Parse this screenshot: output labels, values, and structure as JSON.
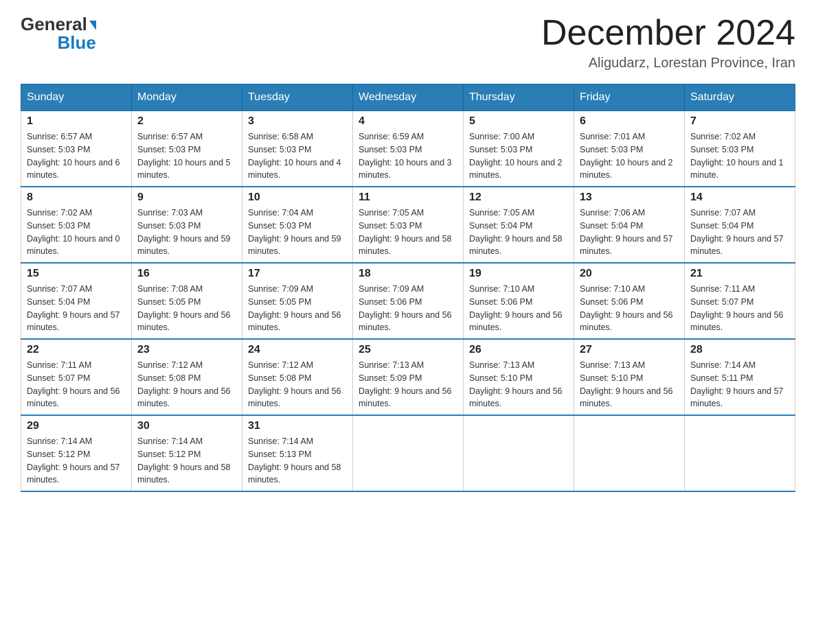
{
  "header": {
    "logo": {
      "general": "General",
      "blue": "Blue"
    },
    "title": "December 2024",
    "subtitle": "Aligudarz, Lorestan Province, Iran"
  },
  "weekdays": [
    "Sunday",
    "Monday",
    "Tuesday",
    "Wednesday",
    "Thursday",
    "Friday",
    "Saturday"
  ],
  "weeks": [
    [
      {
        "day": "1",
        "sunrise": "6:57 AM",
        "sunset": "5:03 PM",
        "daylight": "10 hours and 6 minutes."
      },
      {
        "day": "2",
        "sunrise": "6:57 AM",
        "sunset": "5:03 PM",
        "daylight": "10 hours and 5 minutes."
      },
      {
        "day": "3",
        "sunrise": "6:58 AM",
        "sunset": "5:03 PM",
        "daylight": "10 hours and 4 minutes."
      },
      {
        "day": "4",
        "sunrise": "6:59 AM",
        "sunset": "5:03 PM",
        "daylight": "10 hours and 3 minutes."
      },
      {
        "day": "5",
        "sunrise": "7:00 AM",
        "sunset": "5:03 PM",
        "daylight": "10 hours and 2 minutes."
      },
      {
        "day": "6",
        "sunrise": "7:01 AM",
        "sunset": "5:03 PM",
        "daylight": "10 hours and 2 minutes."
      },
      {
        "day": "7",
        "sunrise": "7:02 AM",
        "sunset": "5:03 PM",
        "daylight": "10 hours and 1 minute."
      }
    ],
    [
      {
        "day": "8",
        "sunrise": "7:02 AM",
        "sunset": "5:03 PM",
        "daylight": "10 hours and 0 minutes."
      },
      {
        "day": "9",
        "sunrise": "7:03 AM",
        "sunset": "5:03 PM",
        "daylight": "9 hours and 59 minutes."
      },
      {
        "day": "10",
        "sunrise": "7:04 AM",
        "sunset": "5:03 PM",
        "daylight": "9 hours and 59 minutes."
      },
      {
        "day": "11",
        "sunrise": "7:05 AM",
        "sunset": "5:03 PM",
        "daylight": "9 hours and 58 minutes."
      },
      {
        "day": "12",
        "sunrise": "7:05 AM",
        "sunset": "5:04 PM",
        "daylight": "9 hours and 58 minutes."
      },
      {
        "day": "13",
        "sunrise": "7:06 AM",
        "sunset": "5:04 PM",
        "daylight": "9 hours and 57 minutes."
      },
      {
        "day": "14",
        "sunrise": "7:07 AM",
        "sunset": "5:04 PM",
        "daylight": "9 hours and 57 minutes."
      }
    ],
    [
      {
        "day": "15",
        "sunrise": "7:07 AM",
        "sunset": "5:04 PM",
        "daylight": "9 hours and 57 minutes."
      },
      {
        "day": "16",
        "sunrise": "7:08 AM",
        "sunset": "5:05 PM",
        "daylight": "9 hours and 56 minutes."
      },
      {
        "day": "17",
        "sunrise": "7:09 AM",
        "sunset": "5:05 PM",
        "daylight": "9 hours and 56 minutes."
      },
      {
        "day": "18",
        "sunrise": "7:09 AM",
        "sunset": "5:06 PM",
        "daylight": "9 hours and 56 minutes."
      },
      {
        "day": "19",
        "sunrise": "7:10 AM",
        "sunset": "5:06 PM",
        "daylight": "9 hours and 56 minutes."
      },
      {
        "day": "20",
        "sunrise": "7:10 AM",
        "sunset": "5:06 PM",
        "daylight": "9 hours and 56 minutes."
      },
      {
        "day": "21",
        "sunrise": "7:11 AM",
        "sunset": "5:07 PM",
        "daylight": "9 hours and 56 minutes."
      }
    ],
    [
      {
        "day": "22",
        "sunrise": "7:11 AM",
        "sunset": "5:07 PM",
        "daylight": "9 hours and 56 minutes."
      },
      {
        "day": "23",
        "sunrise": "7:12 AM",
        "sunset": "5:08 PM",
        "daylight": "9 hours and 56 minutes."
      },
      {
        "day": "24",
        "sunrise": "7:12 AM",
        "sunset": "5:08 PM",
        "daylight": "9 hours and 56 minutes."
      },
      {
        "day": "25",
        "sunrise": "7:13 AM",
        "sunset": "5:09 PM",
        "daylight": "9 hours and 56 minutes."
      },
      {
        "day": "26",
        "sunrise": "7:13 AM",
        "sunset": "5:10 PM",
        "daylight": "9 hours and 56 minutes."
      },
      {
        "day": "27",
        "sunrise": "7:13 AM",
        "sunset": "5:10 PM",
        "daylight": "9 hours and 56 minutes."
      },
      {
        "day": "28",
        "sunrise": "7:14 AM",
        "sunset": "5:11 PM",
        "daylight": "9 hours and 57 minutes."
      }
    ],
    [
      {
        "day": "29",
        "sunrise": "7:14 AM",
        "sunset": "5:12 PM",
        "daylight": "9 hours and 57 minutes."
      },
      {
        "day": "30",
        "sunrise": "7:14 AM",
        "sunset": "5:12 PM",
        "daylight": "9 hours and 58 minutes."
      },
      {
        "day": "31",
        "sunrise": "7:14 AM",
        "sunset": "5:13 PM",
        "daylight": "9 hours and 58 minutes."
      },
      null,
      null,
      null,
      null
    ]
  ]
}
